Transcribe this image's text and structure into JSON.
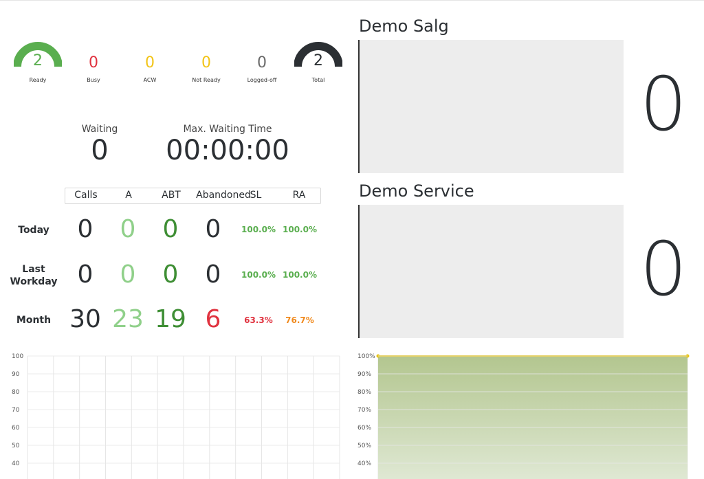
{
  "agents": {
    "ready": {
      "value": "2",
      "label": "Ready",
      "color": "#5aae4f"
    },
    "busy": {
      "value": "0",
      "label": "Busy",
      "color": "#e0323f"
    },
    "acw": {
      "value": "0",
      "label": "ACW",
      "color": "#f2c418"
    },
    "not_ready": {
      "value": "0",
      "label": "Not Ready",
      "color": "#f2c418"
    },
    "logged_off": {
      "value": "0",
      "label": "Logged-off",
      "color": "#6b6b6b"
    },
    "total": {
      "value": "2",
      "label": "Total",
      "color": "#2b2f33"
    }
  },
  "waiting": {
    "label": "Waiting",
    "value": "0",
    "max_label": "Max. Waiting Time",
    "max_value": "00:00:00"
  },
  "stats": {
    "headers": [
      "Calls",
      "A",
      "ABT",
      "Abandoned",
      "SL",
      "RA"
    ],
    "rows": [
      {
        "label": "Today",
        "calls": "0",
        "a": "0",
        "abt": "0",
        "abandoned": "0",
        "sl": "100.0%",
        "ra": "100.0%"
      },
      {
        "label": "Last Workday",
        "calls": "0",
        "a": "0",
        "abt": "0",
        "abandoned": "0",
        "sl": "100.0%",
        "ra": "100.0%"
      },
      {
        "label": "Month",
        "calls": "30",
        "a": "23",
        "abt": "19",
        "abandoned": "6",
        "sl": "63.3%",
        "ra": "76.7%"
      }
    ]
  },
  "colors": {
    "dark": "#2b2f33",
    "light_green": "#90d08a",
    "green": "#3e8e34",
    "red": "#e0323f",
    "pct_green": "#5aae4f",
    "pct_red": "#e0323f",
    "pct_orange": "#f08a1e"
  },
  "queues": [
    {
      "name": "Demo Salg",
      "count": "0"
    },
    {
      "name": "Demo Service",
      "count": "0"
    }
  ],
  "chart_data": [
    {
      "type": "line",
      "yticks": [
        "100",
        "90",
        "80",
        "70",
        "60",
        "50",
        "40"
      ],
      "ylim": [
        30,
        100
      ],
      "grid": true,
      "series": []
    },
    {
      "type": "area",
      "yticks": [
        "100%",
        "90%",
        "80%",
        "70%",
        "60%",
        "50%",
        "40%"
      ],
      "ylim": [
        30,
        100
      ],
      "grid": true,
      "series": [
        {
          "values": [
            100,
            100
          ],
          "line_color": "#e6c416",
          "fill_color": "#b3c68f"
        }
      ]
    }
  ]
}
